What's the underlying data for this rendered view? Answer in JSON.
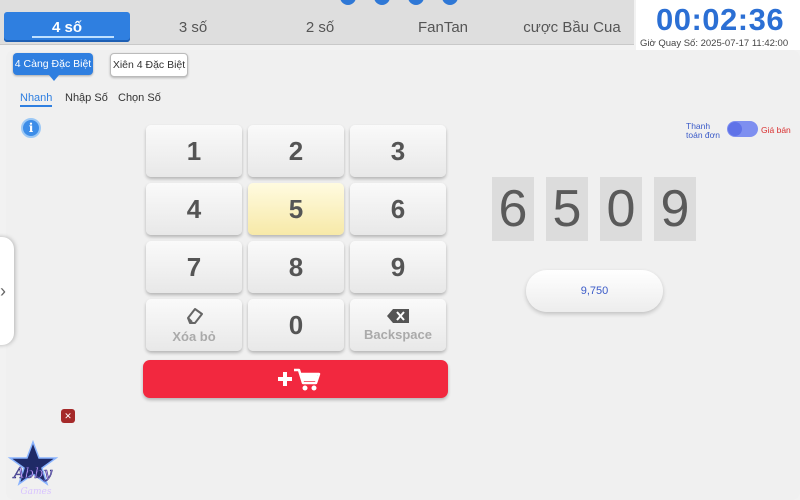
{
  "tabs": [
    {
      "label": "4 số",
      "active": true
    },
    {
      "label": "3 số",
      "active": false
    },
    {
      "label": "2 số",
      "active": false
    },
    {
      "label": "FanTan",
      "active": false
    },
    {
      "label": "cược Bầu Cua",
      "active": false
    }
  ],
  "timer": {
    "countdown": "00:02:36",
    "draw_time": "Giờ Quay Số: 2025-07-17 11:42:00"
  },
  "bet_types": [
    {
      "label": "4 Càng Đặc Biệt",
      "active": true
    },
    {
      "label": "Xiên 4 Đặc Biệt",
      "active": false
    }
  ],
  "modes": [
    {
      "label": "Nhanh",
      "active": true
    },
    {
      "label": "Nhập Số",
      "active": false
    },
    {
      "label": "Chọn Số",
      "active": false
    }
  ],
  "keypad": {
    "keys": [
      "1",
      "2",
      "3",
      "4",
      "5",
      "6",
      "7",
      "8",
      "9",
      "0"
    ],
    "highlighted": "5",
    "clear_label": "Xóa bỏ",
    "backspace_label": "Backspace"
  },
  "selected_digits": [
    "6",
    "5",
    "0",
    "9"
  ],
  "price": "9,750",
  "toggle": {
    "left_label": "Thanh toán đơn",
    "right_label": "Giá bán",
    "state": "left"
  },
  "icons": {
    "info": "info-icon",
    "eraser": "eraser-icon",
    "backspace": "backspace-icon",
    "cart": "add-to-cart-icon",
    "side": "chevron-right-icon",
    "close": "close-icon"
  },
  "colors": {
    "accent": "#2f7fe0",
    "cart": "#f2283f",
    "highlight": "#f7e9a8"
  }
}
